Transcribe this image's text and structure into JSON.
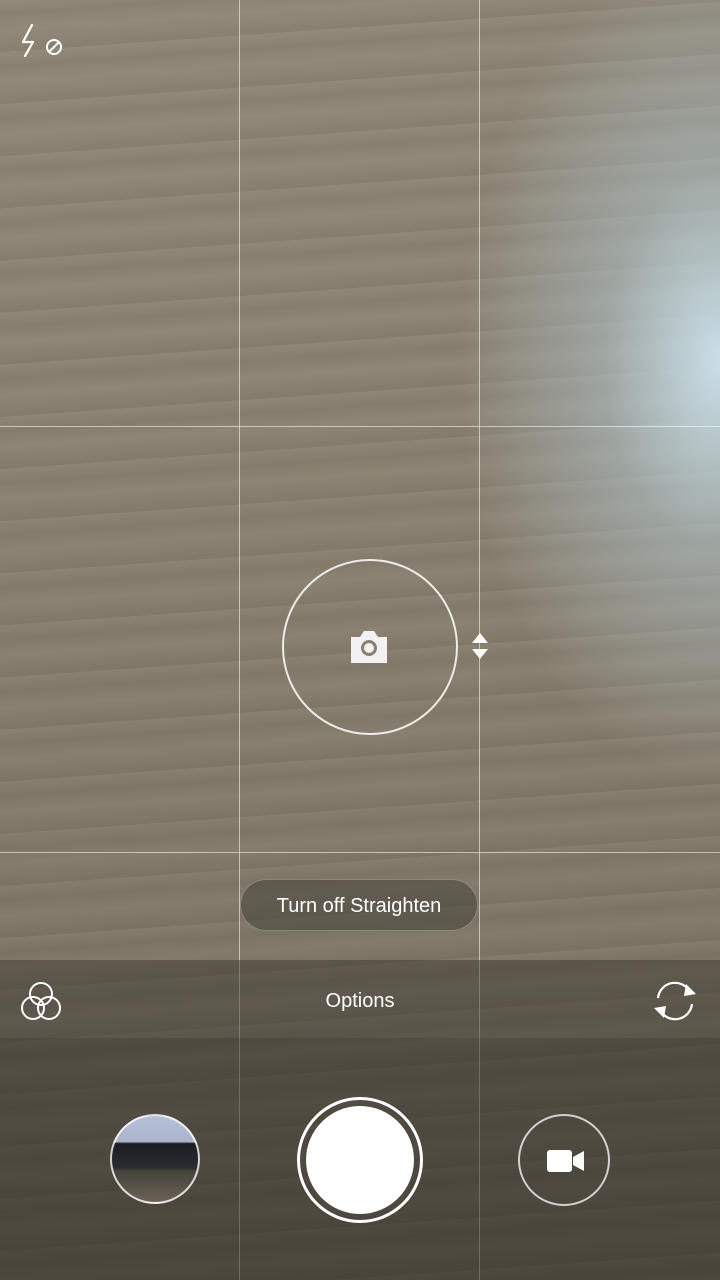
{
  "straighten": {
    "label": "Turn off Straighten"
  },
  "options_bar": {
    "label": "Options"
  },
  "icons": {
    "flash": "flash-off-icon",
    "center_camera": "camera-icon",
    "level": "level-arrows-icon",
    "filters": "filters-icon",
    "switch_camera": "switch-camera-icon",
    "shutter": "shutter-button",
    "video": "video-camera-icon",
    "gallery": "gallery-thumbnail"
  },
  "colors": {
    "overlay_text": "#ffffff",
    "grid_line": "#ffffff"
  }
}
